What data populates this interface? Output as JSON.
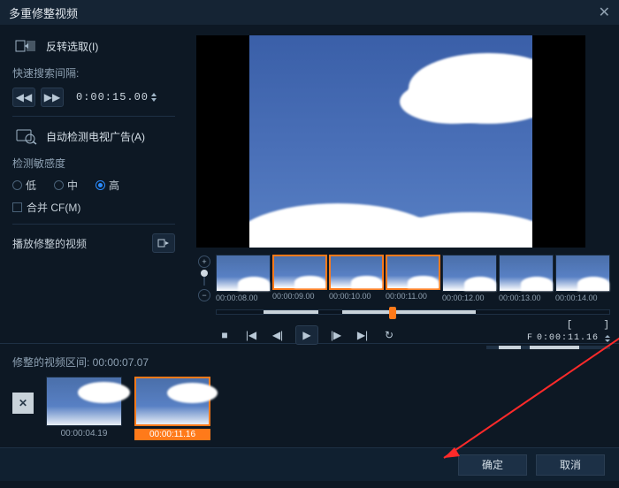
{
  "title": "多重修整视频",
  "sidebar": {
    "invert_label": "反转选取(I)",
    "fast_search_label": "快速搜索间隔:",
    "interval_time": "0:00:15.00",
    "autodetect_label": "自动检测电视广告(A)",
    "sensitivity_label": "检测敏感度",
    "radio_low": "低",
    "radio_mid": "中",
    "radio_high": "高",
    "merge_cf": "合并 CF(M)",
    "play_trimmed": "播放修整的视频"
  },
  "timeline": {
    "thumbs": [
      {
        "t": "00:00:08.00",
        "sel": false
      },
      {
        "t": "00:00:09.00",
        "sel": true
      },
      {
        "t": "00:00:10.00",
        "sel": true
      },
      {
        "t": "00:00:11.00",
        "sel": true
      },
      {
        "t": "00:00:12.00",
        "sel": false
      },
      {
        "t": "00:00:13.00",
        "sel": false
      },
      {
        "t": "00:00:14.00",
        "sel": false
      }
    ],
    "readout": "0:00:11.16"
  },
  "region": {
    "label_prefix": "修整的视频区间: ",
    "duration": "00:00:07.07",
    "clips": [
      {
        "t": "00:00:04.19",
        "active": false
      },
      {
        "t": "00:00:11.16",
        "active": true
      }
    ]
  },
  "footer": {
    "ok": "确定",
    "cancel": "取消"
  }
}
